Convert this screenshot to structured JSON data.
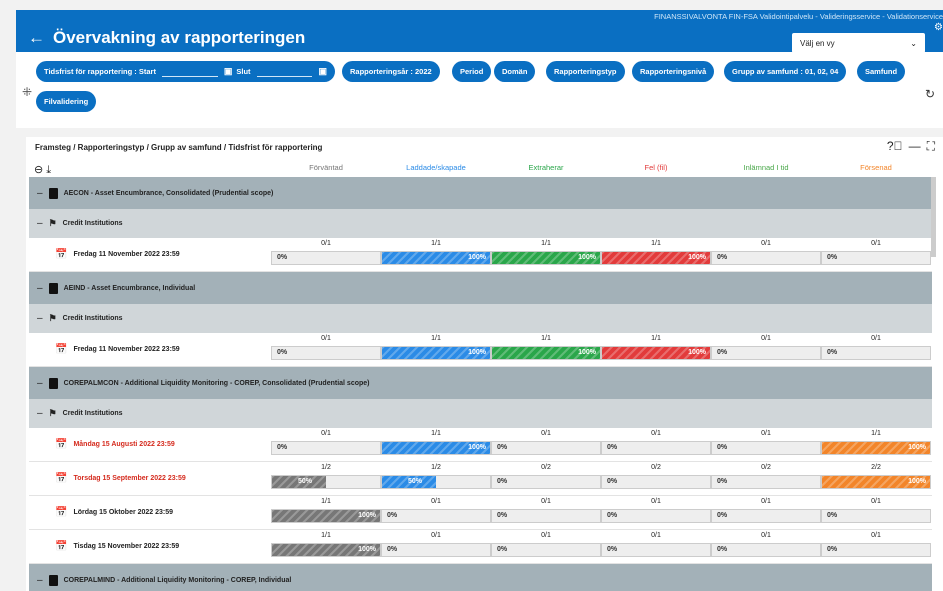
{
  "header": {
    "org": "FINANSSIVALVONTA FIN-FSA Validointipalvelu - Valideringsservice - Validationservice",
    "back_icon": "arrow-left-icon",
    "title": "Övervakning av rapporteringen",
    "view_select": "Välj en vy"
  },
  "filters": {
    "deadline_start": "Tidsfrist för rapportering : Start",
    "deadline_end": "Slut",
    "chips": [
      "Rapporteringsår : 2022",
      "Period",
      "Domän",
      "Rapporteringstyp",
      "Rapporteringsnivå",
      "Grupp av samfund : 01, 02, 04",
      "Samfund"
    ],
    "file_validation": "Filvalidering"
  },
  "panel": {
    "breadcrumb": "Framsteg / Rapporteringstyp / Grupp av samfund / Tidsfrist för rapportering",
    "columns": [
      {
        "label": "Förväntad",
        "color": "#777777"
      },
      {
        "label": "Laddade/skapade",
        "color": "#2b8be6"
      },
      {
        "label": "Extraherar",
        "color": "#2aa64a"
      },
      {
        "label": "Fel (fil)",
        "color": "#e23b3b"
      },
      {
        "label": "Inlämnad I tid",
        "color": "#4aa84a"
      },
      {
        "label": "Försenad",
        "color": "#f2852a"
      }
    ]
  },
  "rows": [
    {
      "type": "g1",
      "label": "AECON - Asset Encumbrance, Consolidated (Prudential scope)"
    },
    {
      "type": "g2",
      "label": "Credit Institutions"
    },
    {
      "type": "d",
      "label": "Fredag 11 November 2022 23:59",
      "late": false,
      "cells": [
        {
          "c": "0/1",
          "v": 0,
          "p": "0%"
        },
        {
          "c": "1/1",
          "v": 1,
          "p": "100%"
        },
        {
          "c": "1/1",
          "v": 1,
          "p": "100%"
        },
        {
          "c": "1/1",
          "v": 1,
          "p": "100%"
        },
        {
          "c": "0/1",
          "v": 0,
          "p": "0%"
        },
        {
          "c": "0/1",
          "v": 0,
          "p": "0%"
        }
      ]
    },
    {
      "type": "g1",
      "label": "AEIND - Asset Encumbrance, Individual"
    },
    {
      "type": "g2",
      "label": "Credit Institutions"
    },
    {
      "type": "d",
      "label": "Fredag 11 November 2022 23:59",
      "late": false,
      "cells": [
        {
          "c": "0/1",
          "v": 0,
          "p": "0%"
        },
        {
          "c": "1/1",
          "v": 1,
          "p": "100%"
        },
        {
          "c": "1/1",
          "v": 1,
          "p": "100%"
        },
        {
          "c": "1/1",
          "v": 1,
          "p": "100%"
        },
        {
          "c": "0/1",
          "v": 0,
          "p": "0%"
        },
        {
          "c": "0/1",
          "v": 0,
          "p": "0%"
        }
      ]
    },
    {
      "type": "g1",
      "label": "COREPALMCON - Additional Liquidity Monitoring - COREP, Consolidated (Prudential scope)"
    },
    {
      "type": "g2",
      "label": "Credit Institutions"
    },
    {
      "type": "d",
      "label": "Måndag 15 Augusti 2022 23:59",
      "late": true,
      "cells": [
        {
          "c": "0/1",
          "v": 0,
          "p": "0%"
        },
        {
          "c": "1/1",
          "v": 1,
          "p": "100%"
        },
        {
          "c": "0/1",
          "v": 0,
          "p": "0%"
        },
        {
          "c": "0/1",
          "v": 0,
          "p": "0%"
        },
        {
          "c": "0/1",
          "v": 0,
          "p": "0%"
        },
        {
          "c": "1/1",
          "v": 1,
          "p": "100%"
        }
      ]
    },
    {
      "type": "d",
      "label": "Torsdag 15 September 2022 23:59",
      "late": true,
      "cells": [
        {
          "c": "1/2",
          "v": 0.5,
          "p": "50%"
        },
        {
          "c": "1/2",
          "v": 0.5,
          "p": "50%"
        },
        {
          "c": "0/2",
          "v": 0,
          "p": "0%"
        },
        {
          "c": "0/2",
          "v": 0,
          "p": "0%"
        },
        {
          "c": "0/2",
          "v": 0,
          "p": "0%"
        },
        {
          "c": "2/2",
          "v": 1,
          "p": "100%"
        }
      ]
    },
    {
      "type": "d",
      "label": "Lördag 15 Oktober 2022 23:59",
      "late": false,
      "cells": [
        {
          "c": "1/1",
          "v": 1,
          "p": "100%"
        },
        {
          "c": "0/1",
          "v": 0,
          "p": "0%"
        },
        {
          "c": "0/1",
          "v": 0,
          "p": "0%"
        },
        {
          "c": "0/1",
          "v": 0,
          "p": "0%"
        },
        {
          "c": "0/1",
          "v": 0,
          "p": "0%"
        },
        {
          "c": "0/1",
          "v": 0,
          "p": "0%"
        }
      ]
    },
    {
      "type": "d",
      "label": "Tisdag 15 November 2022 23:59",
      "late": false,
      "cells": [
        {
          "c": "1/1",
          "v": 1,
          "p": "100%"
        },
        {
          "c": "0/1",
          "v": 0,
          "p": "0%"
        },
        {
          "c": "0/1",
          "v": 0,
          "p": "0%"
        },
        {
          "c": "0/1",
          "v": 0,
          "p": "0%"
        },
        {
          "c": "0/1",
          "v": 0,
          "p": "0%"
        },
        {
          "c": "0/1",
          "v": 0,
          "p": "0%"
        }
      ]
    },
    {
      "type": "g1",
      "label": "COREPALMIND - Additional Liquidity Monitoring - COREP, Individual"
    }
  ]
}
